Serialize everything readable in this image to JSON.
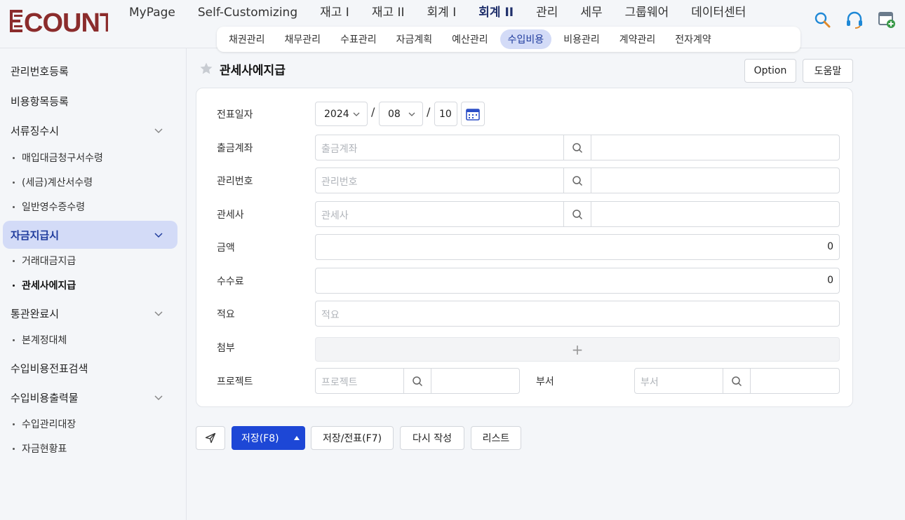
{
  "brand": {
    "logo_text": "ECOUNT",
    "logo_color": "#8b2c2c"
  },
  "mainnav": [
    {
      "label": "MyPage"
    },
    {
      "label": "Self-Customizing"
    },
    {
      "label": "재고 I"
    },
    {
      "label": "재고 II"
    },
    {
      "label": "회계 I"
    },
    {
      "label": "회계 II",
      "active": true
    },
    {
      "label": "관리"
    },
    {
      "label": "세무"
    },
    {
      "label": "그룹웨어"
    },
    {
      "label": "데이터센터"
    }
  ],
  "top_icons": [
    "search-icon",
    "headset-icon",
    "add-window-icon"
  ],
  "subnav": [
    {
      "label": "채권관리"
    },
    {
      "label": "채무관리"
    },
    {
      "label": "수표관리"
    },
    {
      "label": "자금계획"
    },
    {
      "label": "예산관리"
    },
    {
      "label": "수입비용",
      "active": true
    },
    {
      "label": "비용관리"
    },
    {
      "label": "계약관리"
    },
    {
      "label": "전자계약"
    }
  ],
  "sidebar": {
    "items": [
      {
        "label": "관리번호등록"
      },
      {
        "label": "비용항목등록"
      },
      {
        "label": "서류징수시",
        "expandable": true
      },
      {
        "label": "매입대금청구서수령"
      },
      {
        "label": "(세금)계산서수령"
      },
      {
        "label": "일반영수증수령"
      },
      {
        "label": "자금지급시",
        "expandable": true,
        "active": true
      },
      {
        "label": "거래대금지급"
      },
      {
        "label": "관세사에지급",
        "active": true
      },
      {
        "label": "통관완료시",
        "expandable": true
      },
      {
        "label": "본계정대체"
      },
      {
        "label": "수입비용전표검색"
      },
      {
        "label": "수입비용출력물",
        "expandable": true
      },
      {
        "label": "수입관리대장"
      },
      {
        "label": "자금현황표"
      }
    ]
  },
  "page": {
    "title": "관세사에지급",
    "option_label": "Option",
    "help_label": "도움말"
  },
  "form": {
    "date_label": "전표일자",
    "date_year": "2024",
    "date_month": "08",
    "date_day": "10",
    "date_sep": "/",
    "account_label": "출금계좌",
    "account_placeholder": "출금계좌",
    "mgmt_label": "관리번호",
    "mgmt_placeholder": "관리번호",
    "broker_label": "관세사",
    "broker_placeholder": "관세사",
    "amount_label": "금액",
    "amount_value": "0",
    "fee_label": "수수료",
    "fee_value": "0",
    "memo_label": "적요",
    "memo_placeholder": "적요",
    "attach_label": "첨부",
    "attach_plus": "+",
    "project_label": "프로젝트",
    "project_placeholder": "프로젝트",
    "dept_label": "부서",
    "dept_placeholder": "부서"
  },
  "actions": {
    "save": "저장(F8)",
    "save_slip": "저장/전표(F7)",
    "rewrite": "다시 작성",
    "list": "리스트"
  },
  "colors": {
    "primary": "#1d47d6",
    "active_bg": "#d3dbf7"
  }
}
